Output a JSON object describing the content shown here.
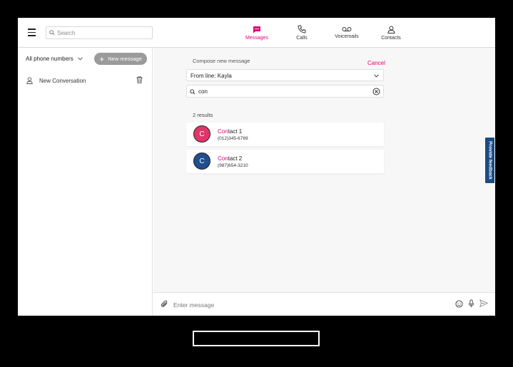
{
  "colors": {
    "accent": "#e20074",
    "avatar1": "#e0356b",
    "avatar2": "#1f4f8c",
    "feedback": "#1b4b82",
    "frame": "#000000"
  },
  "header": {
    "search_placeholder": "Search",
    "nav": [
      {
        "label": "Messages",
        "icon": "chat-bubble-icon",
        "active": true
      },
      {
        "label": "Calls",
        "icon": "phone-icon",
        "active": false
      },
      {
        "label": "Voicemails",
        "icon": "voicemail-icon",
        "active": false
      },
      {
        "label": "Contacts",
        "icon": "contacts-icon",
        "active": false
      }
    ]
  },
  "sidebar": {
    "phone_filter": "All phone numbers",
    "new_message_label": "New message",
    "conversations": [
      {
        "label": "New Conversation"
      }
    ]
  },
  "compose": {
    "title": "Compose new message",
    "cancel_label": "Cancel",
    "from_line": "From line: Kayla",
    "search_value": "con",
    "results_count": "2 results",
    "results": [
      {
        "initial": "C",
        "name_match": "Con",
        "name_rest": "tact 1",
        "phone": "(012)345-6789"
      },
      {
        "initial": "C",
        "name_match": "Con",
        "name_rest": "tact 2",
        "phone": "(987)654-3210"
      }
    ]
  },
  "message_bar": {
    "placeholder": "Enter message"
  },
  "feedback_label": "Provide feedback"
}
